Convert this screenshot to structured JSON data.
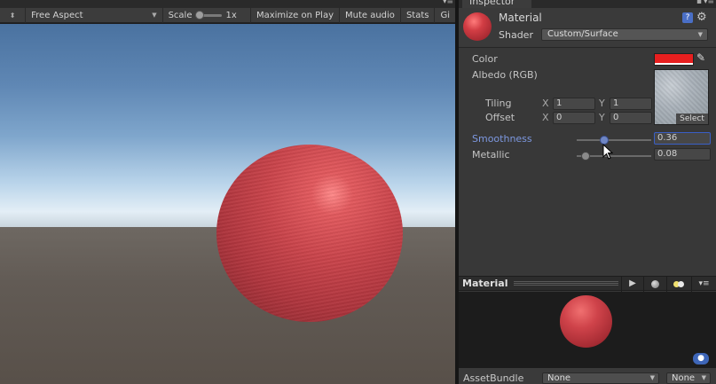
{
  "game_view": {
    "aspect_label": "Free Aspect",
    "scale_label": "Scale",
    "scale_value": "1x",
    "maximize_label": "Maximize on Play",
    "mute_label": "Mute audio",
    "stats_label": "Stats",
    "gizmos_label": "Gi"
  },
  "inspector": {
    "tab_label": "Inspector",
    "material_name": "Material",
    "shader_label": "Shader",
    "shader_value": "Custom/Surface",
    "properties": {
      "color_label": "Color",
      "color_value": "#e81f1f",
      "albedo_label": "Albedo (RGB)",
      "texture_select_label": "Select",
      "tiling_label": "Tiling",
      "offset_label": "Offset",
      "x_label": "X",
      "y_label": "Y",
      "tiling_x": "1",
      "tiling_y": "1",
      "offset_x": "0",
      "offset_y": "0",
      "smoothness_label": "Smoothness",
      "smoothness_value": "0.36",
      "metallic_label": "Metallic",
      "metallic_value": "0.08"
    },
    "preview": {
      "title": "Material"
    },
    "assetbundle": {
      "label": "AssetBundle",
      "name_value": "None",
      "variant_value": "None"
    }
  },
  "icons": [
    "display-arrow-icon",
    "scale-slider-icon",
    "lock-icon",
    "tab-menu-icon",
    "help-icon",
    "gear-icon",
    "eyedropper-icon",
    "play-icon",
    "sphere-icon",
    "lights-icon",
    "tag-icon",
    "cursor-icon"
  ],
  "colors": {
    "accent_blue": "#3a5fc6",
    "material_red": "#c9444b"
  }
}
